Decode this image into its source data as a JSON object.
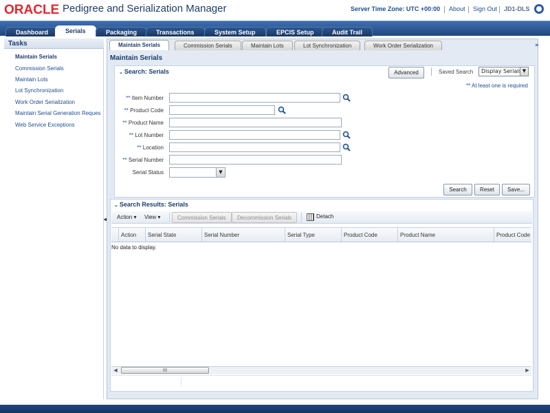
{
  "header": {
    "logo": "ORACLE",
    "app_title": "Pedigree and Serialization Manager",
    "server_time_zone": "Server Time Zone: UTC +00:00",
    "about": "About",
    "sign_out": "Sign Out",
    "user_id": "JD1-DLS",
    "brand_color": "#e3262f"
  },
  "main_tabs": [
    {
      "label": "Dashboard",
      "active": false
    },
    {
      "label": "Serials",
      "active": true
    },
    {
      "label": "Packaging",
      "active": false
    },
    {
      "label": "Transactions",
      "active": false
    },
    {
      "label": "System Setup",
      "active": false
    },
    {
      "label": "EPCIS Setup",
      "active": false
    },
    {
      "label": "Audit Trail",
      "active": false
    }
  ],
  "tasks": {
    "title": "Tasks",
    "items": [
      {
        "label": "Maintain Serials",
        "active": true
      },
      {
        "label": "Commission Serials",
        "active": false
      },
      {
        "label": "Maintain Lots",
        "active": false
      },
      {
        "label": "Lot Synchronization",
        "active": false
      },
      {
        "label": "Work Order Serialization",
        "active": false
      },
      {
        "label": "Maintain Serial Generation Reques",
        "active": false
      },
      {
        "label": "Web Service Exceptions",
        "active": false
      }
    ]
  },
  "sub_tabs": [
    {
      "label": "Maintain Serials",
      "active": true
    },
    {
      "label": "Commission Serials",
      "active": false
    },
    {
      "label": "Maintain Lots",
      "active": false
    },
    {
      "label": "Lot Synchronization",
      "active": false
    },
    {
      "label": "Work Order Serialization",
      "active": false
    }
  ],
  "subtab_more": "»",
  "page": {
    "title": "Maintain Serials",
    "search": {
      "header": "Search: Serials",
      "advanced": "Advanced",
      "saved_search_label": "Saved Search",
      "saved_search_value": "Display Serials",
      "required_note": "** At least one is required",
      "fields": {
        "item_number": {
          "req": "**",
          "label": "Item Number",
          "value": ""
        },
        "product_code": {
          "req": "**",
          "label": "Product Code",
          "value": ""
        },
        "product_name": {
          "req": "**",
          "label": "Product Name",
          "value": ""
        },
        "lot_number": {
          "req": "**",
          "label": "Lot Number",
          "value": ""
        },
        "location": {
          "req": "**",
          "label": "Location",
          "value": ""
        },
        "serial_number": {
          "req": "**",
          "label": "Serial Number",
          "value": ""
        },
        "serial_status": {
          "req": "",
          "label": "Serial Status",
          "value": ""
        }
      },
      "buttons": {
        "search": "Search",
        "reset": "Reset",
        "save": "Save..."
      }
    },
    "results": {
      "header": "Search Results: Serials",
      "toolbar": {
        "action": "Action ▾",
        "view": "View ▾",
        "commission": "Commission Serials",
        "decommission": "Decommission Serials",
        "detach": "Detach"
      },
      "columns": [
        "Action",
        "Serial State",
        "Serial Number",
        "Serial Type",
        "Product Code",
        "Product Name",
        "Product Code"
      ],
      "empty_text": "No data to display.",
      "scroll_thumb_label": "III"
    }
  }
}
